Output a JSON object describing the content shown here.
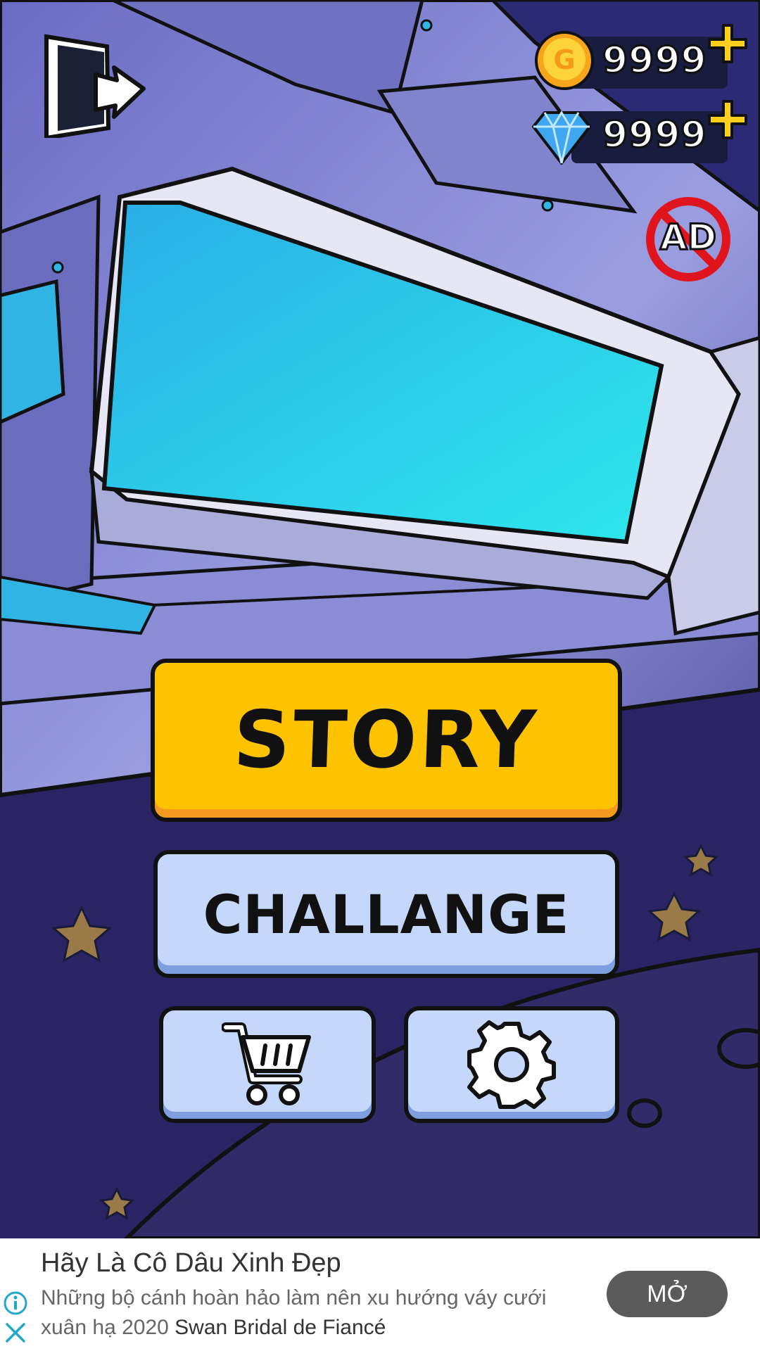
{
  "currency": {
    "coins": "9999",
    "gems": "9999"
  },
  "menu": {
    "story_label": "STORY",
    "challenge_label": "CHALLANGE"
  },
  "remove_ads": {
    "label": "AD"
  },
  "ad_banner": {
    "title": "Hãy Là Cô Dâu Xinh Đẹp",
    "body": "Những bộ cánh hoàn hảo làm nên xu hướng váy cưới xuân hạ 2020 ",
    "brand": "Swan Bridal de Fiancé",
    "cta": "MỞ"
  },
  "colors": {
    "story_button": "#fdc300",
    "secondary_button": "#c5d8fb",
    "window_glass": "#33c7ec",
    "background": "#2a2466"
  }
}
